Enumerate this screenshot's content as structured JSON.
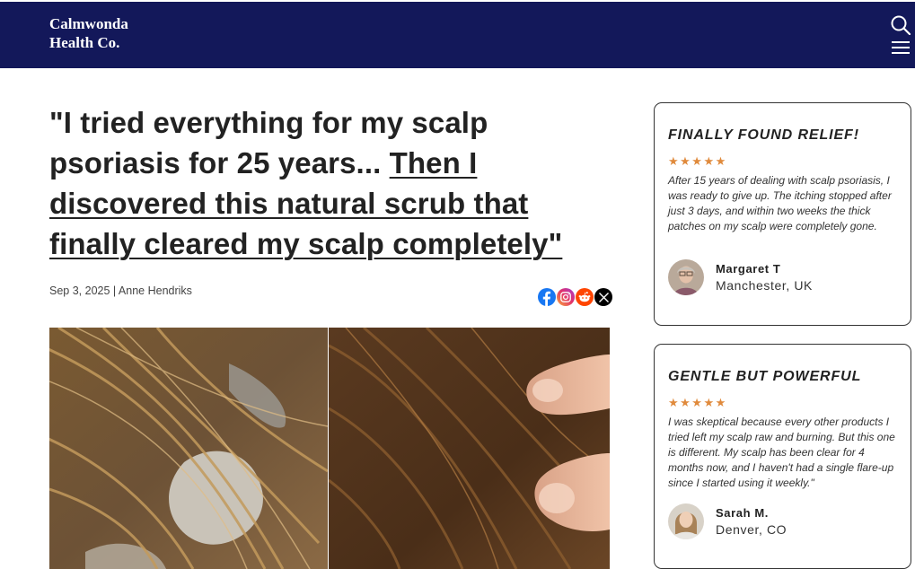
{
  "header": {
    "logo_line1": "Calmwonda",
    "logo_line2": "Health Co.",
    "search_icon": "search-icon",
    "menu_icon": "hamburger-menu-icon",
    "background": "#13185a"
  },
  "article": {
    "headline_plain": "\"I tried everything for my scalp psoriasis for 25 years... ",
    "headline_link": "Then I discovered this natural scrub that finally cleared my scalp completely\"",
    "byline": "Sep  3, 2025 | Anne Hendriks",
    "share_icons": [
      "facebook-icon",
      "instagram-icon",
      "reddit-icon",
      "x-icon"
    ]
  },
  "testimonials": [
    {
      "title": "FINALLY FOUND RELIEF!",
      "stars": "★★★★★",
      "rating": 5,
      "text": "After 15 years of dealing with scalp psoriasis, I was ready to give up. The itching stopped after just 3 days, and within two weeks the thick patches on my scalp were completely gone.",
      "name": "Margaret T",
      "location": "Manchester, UK"
    },
    {
      "title": "GENTLE BUT POWERFUL",
      "stars": "★★★★★",
      "rating": 5,
      "text": "I was skeptical because every other products I tried left my scalp raw and burning. But this one is different. My scalp has been clear for 4 months now, and I haven't had a single flare-up since I started using it weekly.\"",
      "name": "Sarah M.",
      "location": "Denver, CO"
    }
  ],
  "colors": {
    "accent_star": "#e08a3c",
    "navy": "#13185a"
  }
}
